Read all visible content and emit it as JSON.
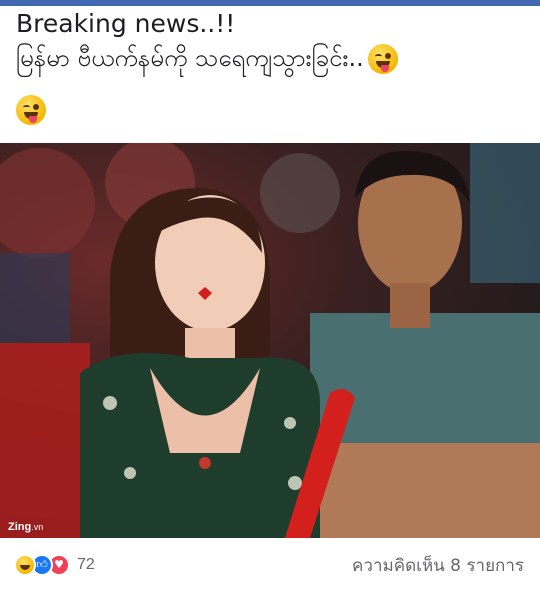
{
  "post": {
    "title_line": "Breaking news..!!",
    "myanmar_line": "မြန်မာ ဗီယက်နမ်ကို သရေကျသွားခြင်း..",
    "emojis": [
      "winking-tongue-emoji",
      "winking-tongue-emoji"
    ]
  },
  "photo": {
    "watermark_brand": "Zing",
    "watermark_suffix": ".vn"
  },
  "footer": {
    "reaction_icons": [
      "haha",
      "like",
      "love"
    ],
    "reaction_count": "72",
    "comment_text": "ความคิดเห็น 8 รายการ"
  },
  "colors": {
    "accent_bar": "#4267b2",
    "like": "#1877f2",
    "love": "#f33e58",
    "meta_text": "#65676b"
  }
}
